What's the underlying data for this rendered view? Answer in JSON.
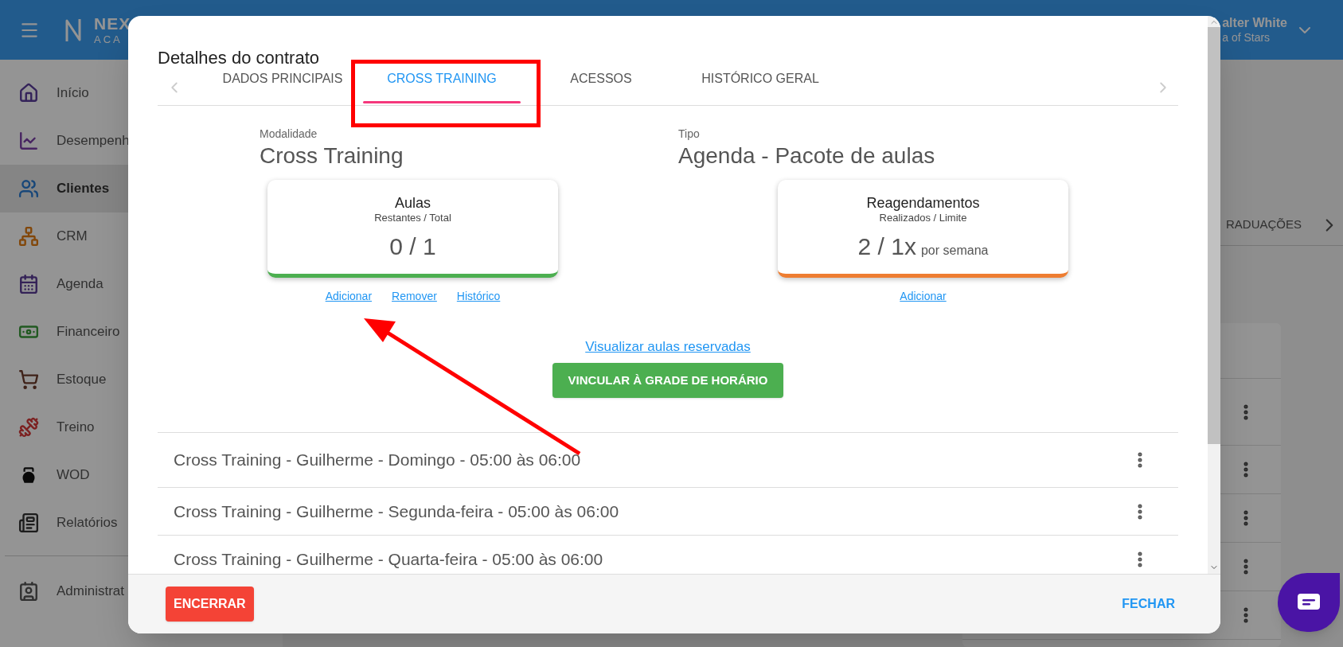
{
  "header": {
    "logo_line_1": "NEX",
    "logo_line_2": "ACA",
    "user_name": "alter White",
    "user_subtitle": "a of Stars"
  },
  "sidebar": {
    "items": [
      {
        "label": "Início",
        "selected": false
      },
      {
        "label": "Desempenh",
        "selected": false
      },
      {
        "label": "Clientes",
        "selected": true
      },
      {
        "label": "CRM",
        "selected": false
      },
      {
        "label": "Agenda",
        "selected": false
      },
      {
        "label": "Financeiro",
        "selected": false
      },
      {
        "label": "Estoque",
        "selected": false
      },
      {
        "label": "Treino",
        "selected": false
      },
      {
        "label": "WOD",
        "selected": false
      },
      {
        "label": "Relatórios",
        "selected": false
      }
    ],
    "admin_items": [
      {
        "label": "Administrat",
        "selected": false
      }
    ]
  },
  "background": {
    "tab_label": "RADUAÇÕES"
  },
  "modal": {
    "title": "Detalhes do contrato",
    "tabs": [
      {
        "label": "DADOS PRINCIPAIS",
        "selected": false
      },
      {
        "label": "CROSS TRAINING",
        "selected": true
      },
      {
        "label": "ACESSOS",
        "selected": false
      },
      {
        "label": "HISTÓRICO GERAL",
        "selected": false
      }
    ],
    "fields": [
      {
        "label": "Modalidade",
        "value": "Cross Training"
      },
      {
        "label": "Tipo",
        "value": "Agenda - Pacote de aulas"
      }
    ],
    "cards": [
      {
        "title": "Aulas",
        "subtitle": "Restantes / Total",
        "value": "0 / 1",
        "color": "#4caf50",
        "links": [
          "Adicionar",
          "Remover",
          "Histórico"
        ]
      },
      {
        "title": "Reagendamentos",
        "subtitle": "Realizados / Limite",
        "value": "2 / 1x",
        "unit": "por semana",
        "color": "#ee7d31",
        "links": [
          "Adicionar"
        ]
      }
    ],
    "view_link": "Visualizar aulas reservadas",
    "bind_button": "VINCULAR À GRADE DE HORÁRIO",
    "schedule": [
      "Cross Training - Guilherme - Domingo - 05:00 às 06:00",
      "Cross Training - Guilherme - Segunda-feira - 05:00 às 06:00",
      "Cross Training - Guilherme - Quarta-feira - 05:00 às 06:00"
    ],
    "end_button": "ENCERRAR",
    "close_button": "FECHAR"
  }
}
